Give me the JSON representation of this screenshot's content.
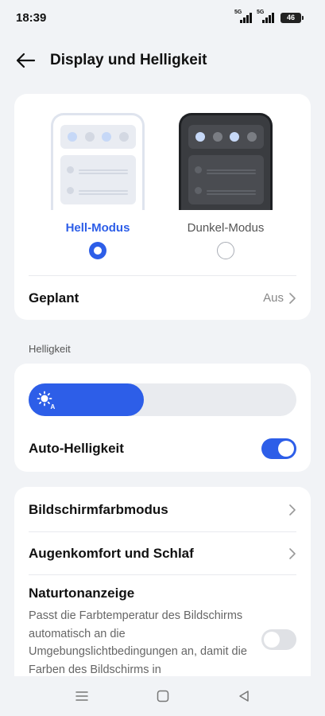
{
  "status": {
    "time": "18:39",
    "network_1": "5G",
    "network_2": "5G",
    "battery": "46"
  },
  "header": {
    "title": "Display und Helligkeit",
    "back_icon": "arrow-left-icon"
  },
  "theme": {
    "light_label": "Hell-Modus",
    "dark_label": "Dunkel-Modus",
    "selected": "light",
    "scheduled_label": "Geplant",
    "scheduled_value": "Aus"
  },
  "brightness": {
    "section_label": "Helligkeit",
    "level_percent": 43,
    "auto_label": "Auto-Helligkeit",
    "auto_on": true
  },
  "more": {
    "color_mode_label": "Bildschirmfarbmodus",
    "eye_comfort_label": "Augenkomfort und Schlaf",
    "natural_tone_label": "Naturtonanzeige",
    "natural_tone_desc": "Passt die Farbtemperatur des Bildschirms automatisch an die Umgebungslichtbedingungen an, damit die Farben des Bildschirms in",
    "natural_tone_on": false
  },
  "colors": {
    "accent": "#2d5ee8",
    "background": "#f1f3f6",
    "card": "#ffffff"
  }
}
